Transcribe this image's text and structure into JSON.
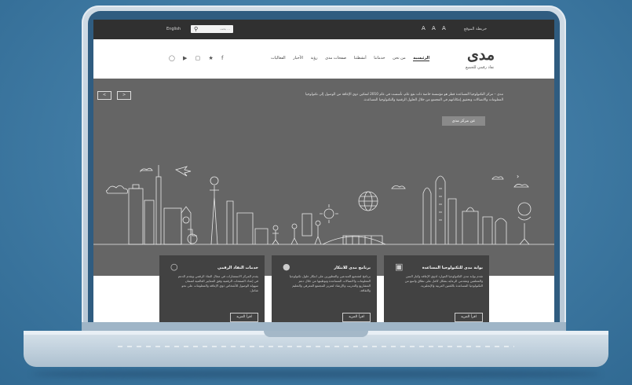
{
  "topbar": {
    "lang": "English",
    "search_placeholder": "بحث ...",
    "font_sizes": "A A A",
    "sitemap": "خريطة الموقع"
  },
  "social_icons": [
    "github-icon",
    "youtube-icon",
    "instagram-icon",
    "twitter-icon",
    "facebook-icon"
  ],
  "social_glyphs": "◯ ▶ ▢ ★ f",
  "nav": {
    "items": [
      "الرئيسية",
      "من نحن",
      "خدماتنا",
      "أنشطتنا",
      "صفحات مدى",
      "رؤية",
      "الأخبار",
      "الفعاليات"
    ]
  },
  "logo": {
    "name": "مدى",
    "tagline": "نفاذ رقمي للجميع"
  },
  "hero": {
    "prev": "<",
    "next_btn": ">",
    "text": "مدى – مركز التكنولوجيا المساعدة قطر هو مؤسسة خاصة ذات نفع عام، تأسست في عام 2010 لتمكين ذوي الإعاقة من الوصول إلى تكنولوجيا المعلومات والاتصالات وتحقيق إمكاناتهم في المجتمع من خلال الحلول الرقمية والتكنولوجيا المساعدة.",
    "button": "عن مركز مدى",
    "slide_arrow": "›"
  },
  "cards": [
    {
      "title": "بوابة مدى للتكنولوجيا المساعدة",
      "body": "تقدم بوابة مدى التكنولوجيا الموارد لذوي الإعاقة وكبار السن والمعلمين ومقدمي الرعاية بشكل كامل على نطاق واسع من التكنولوجيا المساعدة باللغتين العربية والإنجليزية.",
      "button": "اقرأ المزيد",
      "icon": "laptop-icon"
    },
    {
      "title": "برنامج مدى للابتكار",
      "body": "برنامج لتشجيع المبدعين والمطورين على ابتكار حلول تكنولوجيا المعلومات والاتصالات المساعدة وتوطينها من خلال دعم المشاريع والتدريب والإرشاد لتعزيز المجتمع المعرفي والتعليم والثقافة.",
      "button": "اقرأ المزيد",
      "icon": "lightbulb-icon"
    },
    {
      "title": "خدمات النفاذ الرقمي",
      "body": "يقدم المركز الاستشارات في مجال النفاذ الرقمي ويقدم الدعم في إعداد الصفحات الرقمية وفق المعايير العالمية لضمان سهولة الوصول للأشخاص ذوي الإعاقة والمعلومات على نحو شامل.",
      "button": "اقرأ المزيد",
      "icon": "mouse-icon"
    }
  ]
}
